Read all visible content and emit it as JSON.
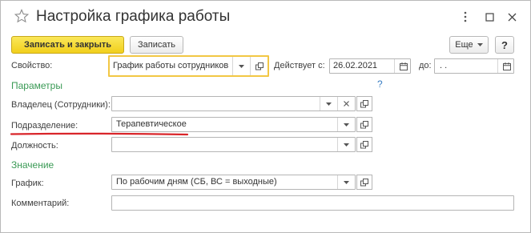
{
  "window": {
    "title": "Настройка графика работы"
  },
  "toolbar": {
    "save_close_label": "Записать и закрыть",
    "save_label": "Записать",
    "more_label": "Еще",
    "help_label": "?"
  },
  "property": {
    "label": "Свойство:",
    "value": "График работы сотрудников"
  },
  "valid_from": {
    "label": "Действует с:",
    "value": "26.02.2021"
  },
  "valid_to": {
    "label": "до:",
    "value": " .  ."
  },
  "parameters": {
    "heading": "Параметры",
    "help": "?",
    "owner_label": "Владелец (Сотрудники):",
    "owner_value": "",
    "department_label": "Подразделение:",
    "department_value": "Терапевтическое",
    "position_label": "Должность:",
    "position_value": ""
  },
  "value_section": {
    "heading": "Значение",
    "schedule_label": "График:",
    "schedule_value": "По рабочим дням (СБ, ВС = выходные)",
    "comment_label": "Комментарий:",
    "comment_value": ""
  },
  "colors": {
    "accent_yellow": "#f2c744",
    "section_green": "#3a9a55",
    "annotation_red": "#d9252a",
    "help_blue": "#3b7fc4"
  }
}
